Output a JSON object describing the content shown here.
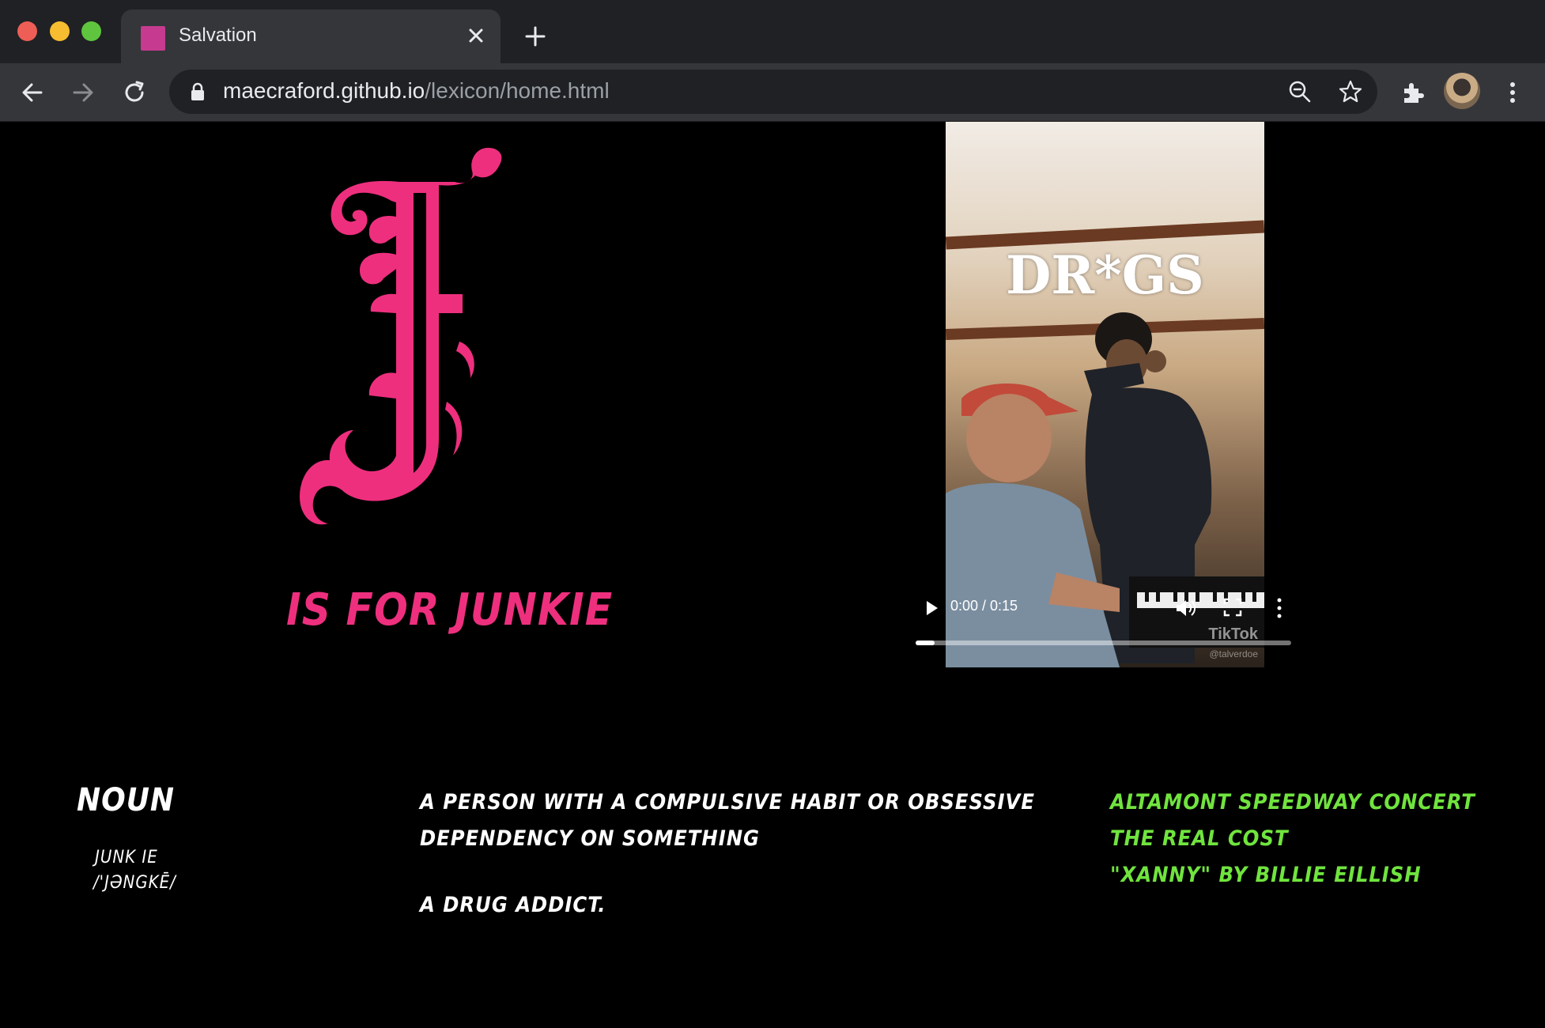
{
  "browser": {
    "tab_title": "Salvation",
    "url_host": "maecraford.github.io",
    "url_path": "/lexicon/home.html"
  },
  "page": {
    "letter": "J",
    "heading": "is for Junkie",
    "part_of_speech": "noun",
    "word": "junk ie",
    "pronunciation": "/'jəngkē/",
    "definitions": [
      "a person with a compulsive habit or obsessive dependency on something",
      "a drug addict."
    ],
    "links": [
      "Altamont Speedway Concert",
      "The Real Cost",
      "\"Xanny\" by Billie Eillish"
    ],
    "video": {
      "caption": "DR*GS",
      "watermark": "TikTok",
      "handle": "@talverdoe",
      "time": "0:00 / 0:15",
      "progress": 0.05
    }
  },
  "colors": {
    "accent_pink": "#ee2f7e",
    "link_green": "#70e43e",
    "background": "#000000"
  },
  "icons": [
    "back-icon",
    "forward-icon",
    "reload-icon",
    "lock-icon",
    "zoom-icon",
    "star-icon",
    "extensions-icon",
    "menu-icon",
    "close-icon",
    "plus-icon",
    "play-icon",
    "volume-icon",
    "fullscreen-icon",
    "more-icon"
  ]
}
